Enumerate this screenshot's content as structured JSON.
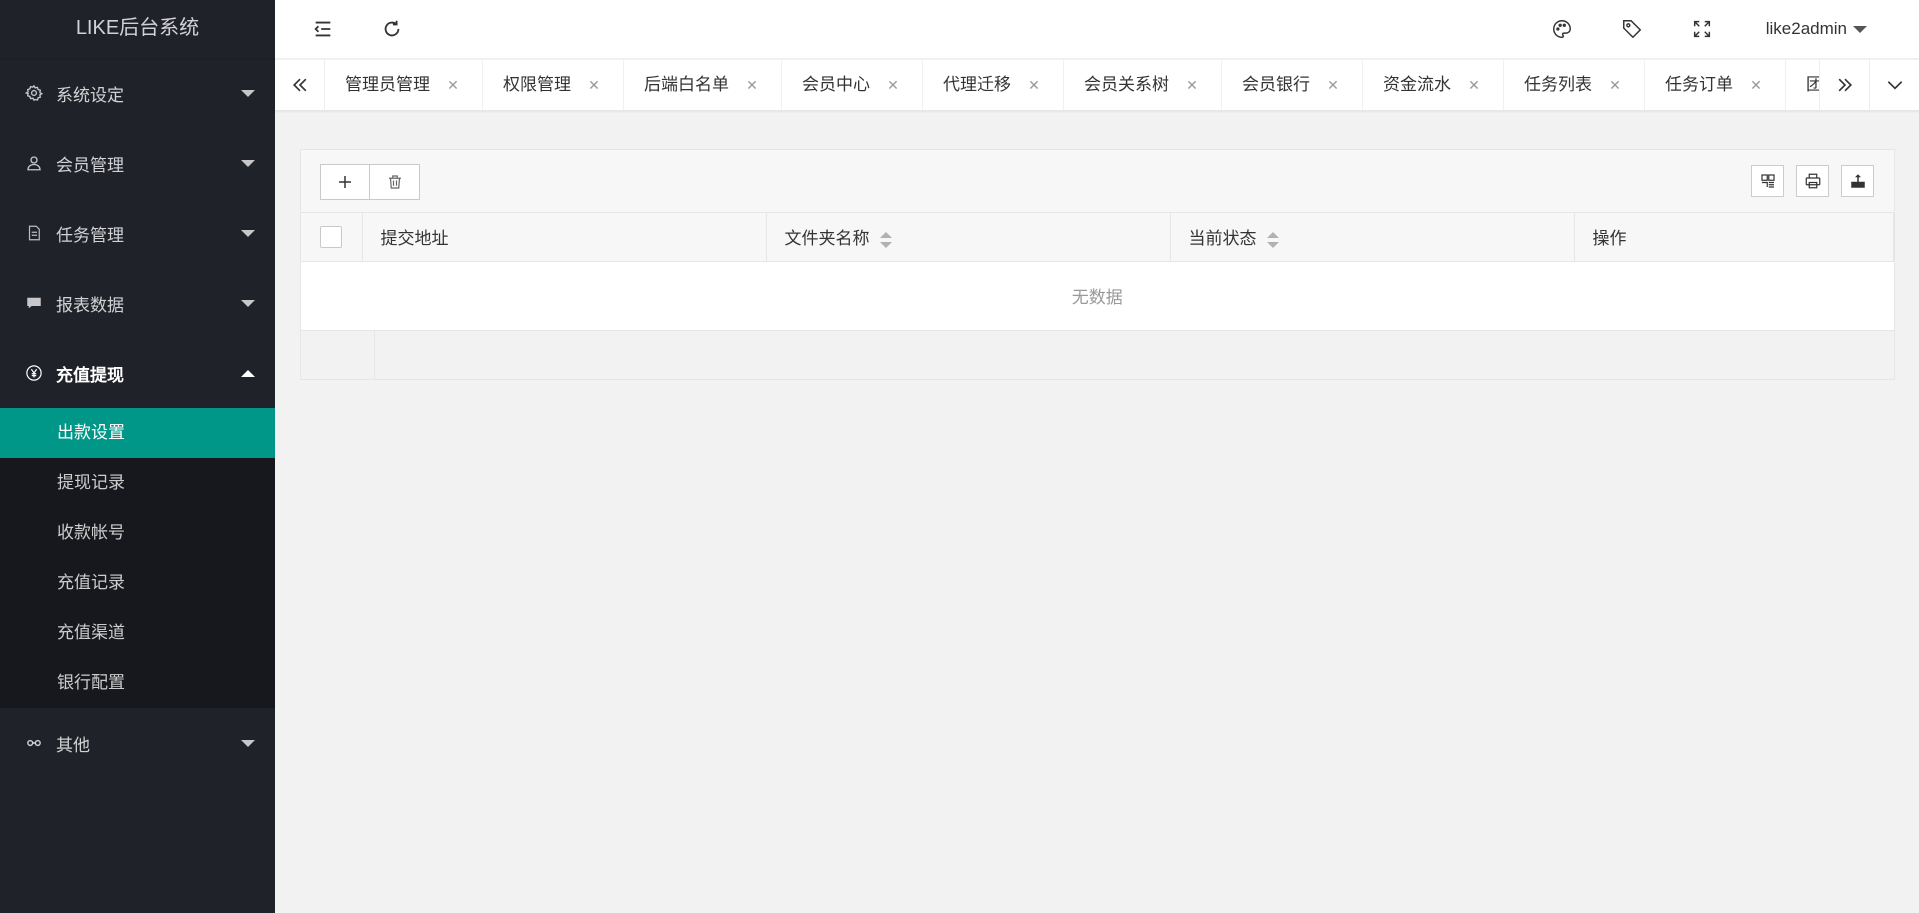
{
  "app": {
    "title": "LIKE后台系统"
  },
  "sidebar": {
    "groups": [
      {
        "label": "系统设定",
        "icon": "gear-icon",
        "open": false
      },
      {
        "label": "会员管理",
        "icon": "user-icon",
        "open": false
      },
      {
        "label": "任务管理",
        "icon": "document-icon",
        "open": false
      },
      {
        "label": "报表数据",
        "icon": "chat-icon",
        "open": false
      },
      {
        "label": "充值提现",
        "icon": "yen-icon",
        "open": true,
        "items": [
          {
            "label": "出款设置",
            "active": true
          },
          {
            "label": "提现记录"
          },
          {
            "label": "收款帐号"
          },
          {
            "label": "充值记录"
          },
          {
            "label": "充值渠道"
          },
          {
            "label": "银行配置"
          }
        ]
      },
      {
        "label": "其他",
        "icon": "link-icon",
        "open": false
      }
    ]
  },
  "header": {
    "user": "like2admin",
    "icons": [
      "menu-collapse-icon",
      "refresh-icon",
      "theme-palette-icon",
      "tag-icon",
      "fullscreen-icon"
    ]
  },
  "tabs": [
    {
      "label": "管理员管理"
    },
    {
      "label": "权限管理"
    },
    {
      "label": "后端白名单"
    },
    {
      "label": "会员中心"
    },
    {
      "label": "代理迁移"
    },
    {
      "label": "会员关系树"
    },
    {
      "label": "会员银行"
    },
    {
      "label": "资金流水"
    },
    {
      "label": "任务列表"
    },
    {
      "label": "任务订单"
    },
    {
      "label": "团队"
    }
  ],
  "tab_close_glyph": "✕",
  "table": {
    "columns": [
      "提交地址",
      "文件夹名称",
      "当前状态",
      "操作"
    ],
    "empty_text": "无数据"
  },
  "colors": {
    "sidebar_bg": "#20222a",
    "active": "#009688"
  }
}
